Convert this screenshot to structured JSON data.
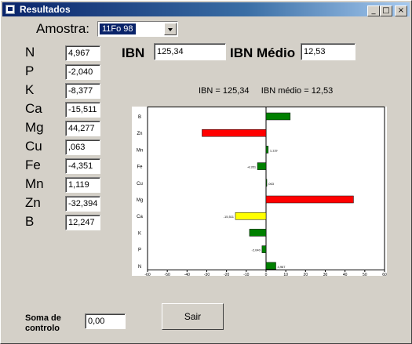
{
  "window": {
    "title": "Resultados",
    "min_label": "_",
    "max_label": "□",
    "close_label": "×"
  },
  "amostra": {
    "label": "Amostra:",
    "selected": "11Fo 98"
  },
  "elements": [
    {
      "label": "N",
      "value": "4,967"
    },
    {
      "label": "P",
      "value": "-2,040"
    },
    {
      "label": "K",
      "value": "-8,377"
    },
    {
      "label": "Ca",
      "value": "-15,511"
    },
    {
      "label": "Mg",
      "value": "44,277"
    },
    {
      "label": "Cu",
      "value": ",063"
    },
    {
      "label": "Fe",
      "value": "-4,351"
    },
    {
      "label": "Mn",
      "value": "1,119"
    },
    {
      "label": "Zn",
      "value": "-32,394"
    },
    {
      "label": "B",
      "value": "12,247"
    }
  ],
  "ibn": {
    "label": "IBN",
    "value": "125,34"
  },
  "ibn_medio": {
    "label": "IBN Médio",
    "value": "12,53"
  },
  "chart_title": "IBN = 125,34     IBN médio = 12,53",
  "soma": {
    "label_line1": "Soma de",
    "label_line2": "controlo",
    "value": "0,00"
  },
  "sair_label": "Sair",
  "colors": {
    "negative_strong": "#ff0000",
    "negative_mid": "#ffff00",
    "small": "#008000"
  },
  "chart_data": {
    "type": "bar",
    "orientation": "horizontal",
    "categories": [
      "B",
      "Zn",
      "Mn",
      "Fe",
      "Cu",
      "Mg",
      "Ca",
      "K",
      "P",
      "N"
    ],
    "values": [
      12.247,
      -32.394,
      1.119,
      -4.351,
      0.063,
      44.277,
      -15.511,
      -8.377,
      -2.04,
      4.967
    ],
    "value_labels": [
      "",
      "",
      "1,119",
      "-4,351",
      ",063",
      "",
      "-15,511",
      "",
      "-2,040",
      "4,967"
    ],
    "bar_colors": [
      "#008000",
      "#ff0000",
      "#008000",
      "#008000",
      "#008000",
      "#ff0000",
      "#ffff00",
      "#008000",
      "#008000",
      "#008000"
    ],
    "xlim": [
      -60,
      60
    ],
    "xticks": [
      "-60",
      "-50",
      "-40",
      "-30",
      "-20",
      "-10",
      "0",
      "10",
      "20",
      "30",
      "40",
      "50",
      "60"
    ],
    "title": "IBN = 125,34     IBN médio = 12,53",
    "grid": false
  }
}
